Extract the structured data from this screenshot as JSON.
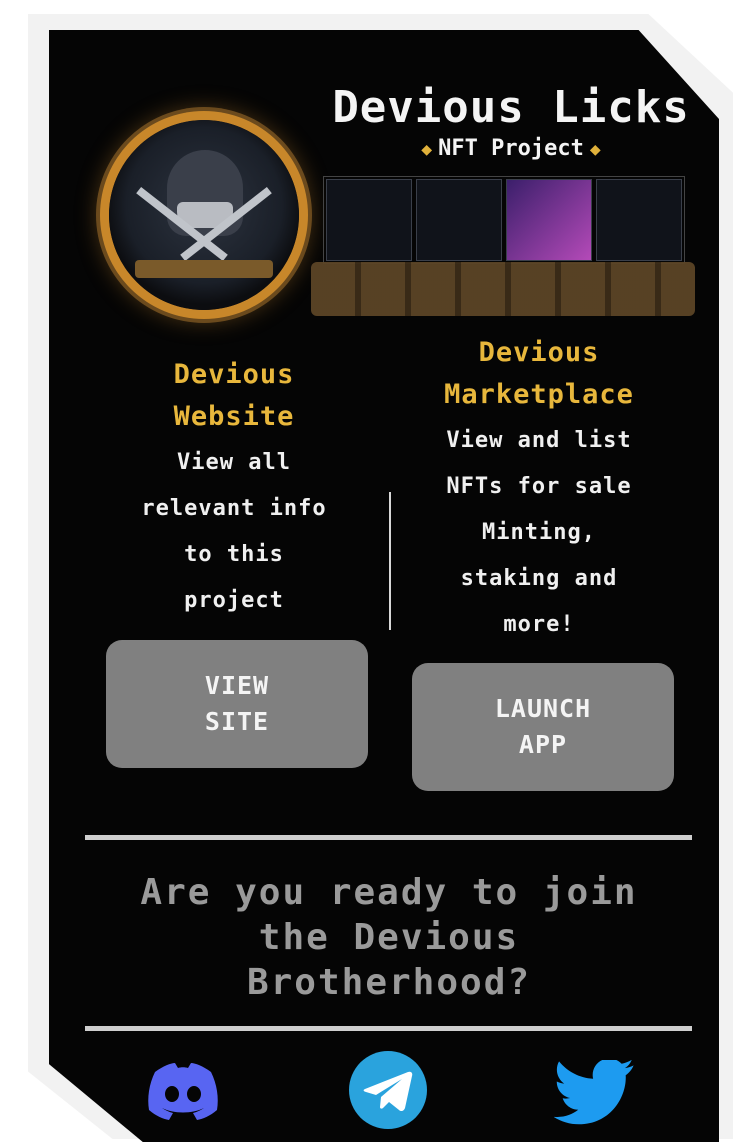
{
  "header": {
    "title": "Devious Licks",
    "subtitle": "NFT Project",
    "diamond_left": "◆",
    "diamond_right": "◆"
  },
  "website": {
    "title_line1": "Devious",
    "title_line2": "Website",
    "desc_lines": [
      "View all",
      "relevant info",
      "to this",
      "project"
    ],
    "button_line1": "VIEW",
    "button_line2": "SITE"
  },
  "marketplace": {
    "title_line1": "Devious",
    "title_line2": "Marketplace",
    "desc_lines": [
      "View and list",
      "NFTs for sale",
      "Minting,",
      "staking and",
      "more!"
    ],
    "button_line1": "LAUNCH",
    "button_line2": "APP"
  },
  "join": {
    "line1": "Are you ready to join",
    "line2": "the Devious",
    "line3": "Brotherhood?"
  },
  "social": {
    "discord": "discord-icon",
    "telegram": "telegram-icon",
    "twitter": "twitter-icon"
  },
  "colors": {
    "background": "#050505",
    "accent_gold": "#e8b73c",
    "button_gray": "#808080",
    "discord": "#5865f2",
    "telegram": "#2aa3dd",
    "twitter": "#1d9bf0"
  }
}
